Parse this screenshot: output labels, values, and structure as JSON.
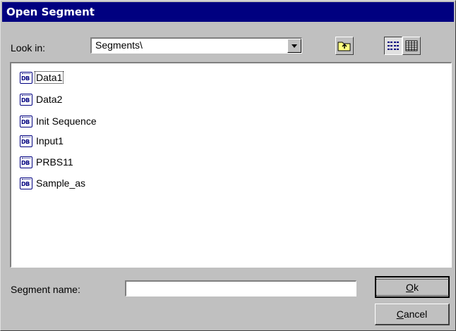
{
  "window": {
    "title": "Open Segment"
  },
  "lookin": {
    "label": "Look in:",
    "value": "Segments\\"
  },
  "toolbar": {
    "up_folder_icon": "up-folder-icon",
    "list_view_icon": "list-view-icon",
    "details_view_icon": "details-view-icon"
  },
  "files": [
    {
      "icon": "DB",
      "name": "Data1"
    },
    {
      "icon": "DB",
      "name": "Data2"
    },
    {
      "icon": "DB",
      "name": "Init Sequence"
    },
    {
      "icon": "DB",
      "name": "Input1"
    },
    {
      "icon": "DB",
      "name": "PRBS11"
    },
    {
      "icon": "DB",
      "name": "Sample_as"
    }
  ],
  "segment_name": {
    "label": "Segment name:",
    "value": ""
  },
  "buttons": {
    "ok_mnemonic": "O",
    "ok_rest": "k",
    "cancel_mnemonic": "C",
    "cancel_rest": "ancel"
  },
  "colors": {
    "titlebar": "#000080",
    "face": "#c0c0c0"
  }
}
